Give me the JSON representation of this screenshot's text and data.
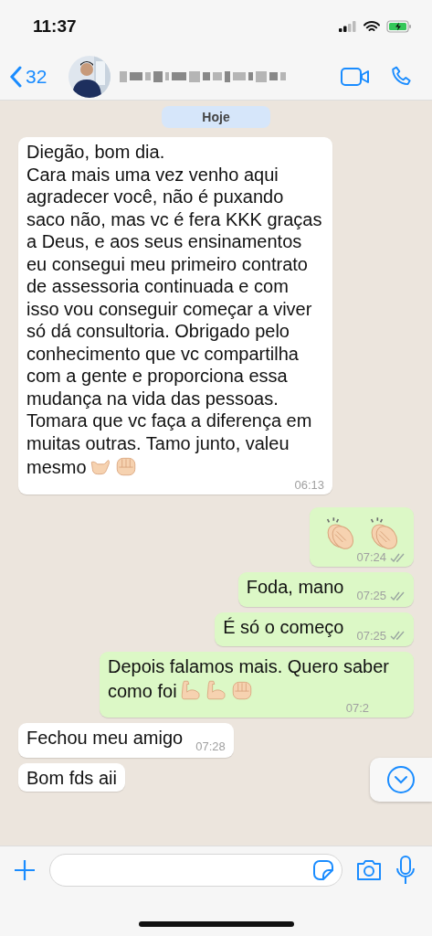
{
  "status_bar": {
    "time": "11:37"
  },
  "header": {
    "back_count": "32"
  },
  "date_chip": "Hoje",
  "messages": [
    {
      "outgoing": false,
      "text": "Diegão, bom dia.\nCara mais uma vez venho aqui agradecer você, não é puxando saco não, mas vc é fera KKK graças a Deus, e aos seus ensinamentos eu consegui meu primeiro contrato de assessoria continuada e com isso vou conseguir começar a viver só dá consultoria. Obrigado pelo conhecimento que vc compartilha com a gente e proporciona essa mudança na vida das pessoas. Tomara que vc faça a diferença em muitas outras. Tamo junto, valeu mesmo",
      "emojis": [
        {
          "kind": "callme"
        },
        {
          "kind": "fist"
        }
      ],
      "time": "06:13"
    },
    {
      "outgoing": true,
      "emojis": [
        {
          "kind": "clap"
        },
        {
          "kind": "clap"
        }
      ],
      "time": "07:24",
      "read": true
    },
    {
      "outgoing": true,
      "text": "Foda, mano",
      "time": "07:25",
      "read": true
    },
    {
      "outgoing": true,
      "text": "É só o começo",
      "time": "07:25",
      "read": true
    },
    {
      "outgoing": true,
      "text": "Depois falamos mais. Quero saber como foi",
      "emojis": [
        {
          "kind": "muscle"
        },
        {
          "kind": "muscle"
        },
        {
          "kind": "fist"
        }
      ],
      "time": "07:2"
    },
    {
      "outgoing": false,
      "text": "Fechou meu amigo",
      "time": "07:28"
    },
    {
      "outgoing": false,
      "text": "Bom fds aii"
    }
  ]
}
